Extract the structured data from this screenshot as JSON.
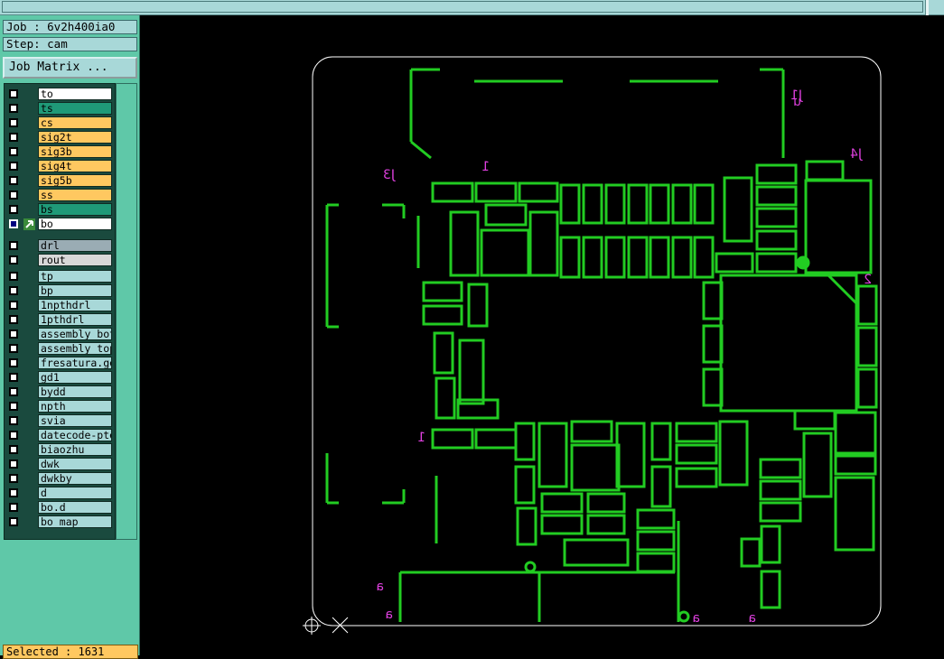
{
  "topbar": {
    "title": ""
  },
  "job": {
    "label": "Job : 6v2h400ia0"
  },
  "step": {
    "label": "Step: cam"
  },
  "job_matrix": {
    "label": "Job Matrix ..."
  },
  "layers_group1": [
    {
      "name": "to",
      "color": "#ffffff"
    },
    {
      "name": "ts",
      "color": "#1f9a78"
    },
    {
      "name": "cs",
      "color": "#ffc860"
    },
    {
      "name": "sig2t",
      "color": "#ffc860"
    },
    {
      "name": "sig3b",
      "color": "#ffc860"
    },
    {
      "name": "sig4t",
      "color": "#ffc860"
    },
    {
      "name": "sig5b",
      "color": "#ffc860"
    },
    {
      "name": "ss",
      "color": "#ffc860"
    },
    {
      "name": "bs",
      "color": "#1f9a78"
    },
    {
      "name": "bo",
      "color": "#ffffff",
      "active": true
    }
  ],
  "layers_group2": [
    {
      "name": "drl",
      "color": "#9aacb4"
    },
    {
      "name": "rout",
      "color": "#d8d8d8"
    }
  ],
  "layers_group3": [
    {
      "name": "tp",
      "color": "#a8d8d8"
    },
    {
      "name": "bp",
      "color": "#a8d8d8"
    },
    {
      "name": "1npthdrl",
      "color": "#a8d8d8"
    },
    {
      "name": "1pthdrl",
      "color": "#a8d8d8"
    },
    {
      "name": "assembly_bot",
      "color": "#a8d8d8"
    },
    {
      "name": "assembly_top",
      "color": "#a8d8d8"
    },
    {
      "name": "fresatura.ge",
      "color": "#a8d8d8"
    },
    {
      "name": "gd1",
      "color": "#a8d8d8"
    },
    {
      "name": "bydd",
      "color": "#a8d8d8"
    },
    {
      "name": "npth",
      "color": "#a8d8d8"
    },
    {
      "name": "svia",
      "color": "#a8d8d8"
    },
    {
      "name": "datecode-pte",
      "color": "#a8d8d8"
    },
    {
      "name": "biaozhu",
      "color": "#a8d8d8"
    },
    {
      "name": "dwk",
      "color": "#a8d8d8"
    },
    {
      "name": "dwkby",
      "color": "#a8d8d8"
    },
    {
      "name": "d",
      "color": "#a8d8d8"
    },
    {
      "name": "bo.d",
      "color": "#a8d8d8"
    },
    {
      "name": "bo_map",
      "color": "#a8d8d8"
    }
  ],
  "status": {
    "label": "Selected : 1631"
  },
  "canvas": {
    "outline_color": "#ffffff",
    "feature_color": "#22cc22",
    "text_color": "#e040e0",
    "labels": [
      "J1",
      "J4",
      "J3",
      "1",
      "2",
      "1",
      "a",
      "a",
      "a",
      "a",
      "u"
    ]
  },
  "icons": {
    "datum": "crosshair-icon",
    "cursor": "x-cursor-icon",
    "layer_active": "arrow-icon"
  }
}
